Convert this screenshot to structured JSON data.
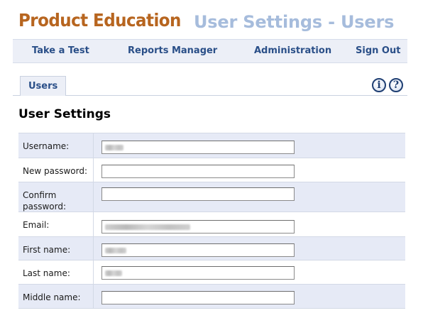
{
  "header": {
    "brand": "Product Education",
    "page_heading": "User Settings - Users"
  },
  "nav": {
    "items": [
      {
        "label": "Take a Test"
      },
      {
        "label": "Reports Manager"
      },
      {
        "label": "Administration"
      },
      {
        "label": "Sign Out"
      }
    ]
  },
  "tabs": {
    "active": "Users",
    "icons": [
      "info-icon",
      "help-icon"
    ]
  },
  "section": {
    "title": "User Settings"
  },
  "form": {
    "rows": [
      {
        "label": "Username:",
        "value_redacted": true
      },
      {
        "label": "New password:",
        "value_redacted": false
      },
      {
        "label": "Confirm password:",
        "value_redacted": false
      },
      {
        "label": "Email:",
        "value_redacted": true
      },
      {
        "label": "First name:",
        "value_redacted": true
      },
      {
        "label": "Last name:",
        "value_redacted": true
      },
      {
        "label": "Middle name:",
        "value_redacted": false
      }
    ]
  },
  "colors": {
    "brand": "#b7651f",
    "heading": "#a6bcdc",
    "nav_text": "#2a4f88",
    "row_alt": "#e6eaf6"
  }
}
